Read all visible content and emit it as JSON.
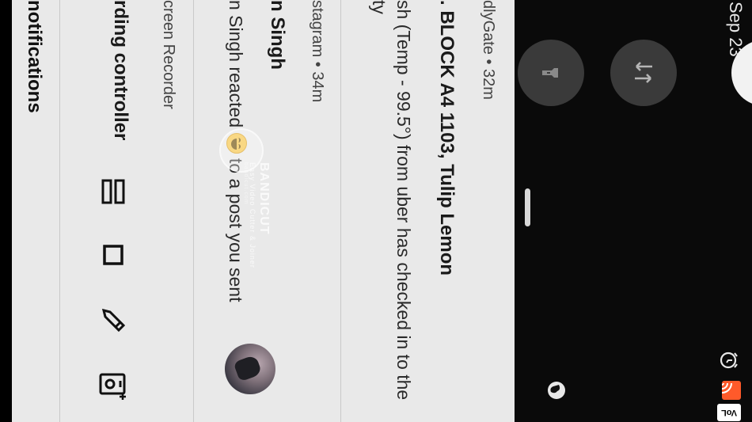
{
  "status_bar": {
    "date": "Sep 23",
    "icons": [
      "alarm-icon",
      "cast-icon",
      "volte-icon"
    ],
    "volte_label": "VoL"
  },
  "quick_settings": {
    "tiles": [
      {
        "name": "data-transfer-tile",
        "icon": "swap-arrows-icon"
      },
      {
        "name": "flashlight-tile",
        "icon": "flashlight-icon"
      },
      {
        "name": "auto-rotate-tile",
        "icon": "rotate-icon"
      },
      {
        "name": "battery-saver-tile",
        "icon": "battery-plus-icon"
      }
    ],
    "corner_icon": "globe-icon"
  },
  "notifications": [
    {
      "app_meta": "dlyGate • 32m",
      "title": ". BLOCK A4 1103, Tulip Lemon",
      "body_lines": [
        "sh (Temp - 99.5°) from uber has checked in to the",
        "ty"
      ]
    },
    {
      "app_meta": "stagram • 34m",
      "title": "n Singh",
      "body_before_emoji": "n Singh reacted ",
      "body_after_emoji": " to a post you sent",
      "emoji_name": "laughing-emoji-icon"
    },
    {
      "app_meta": "creen Recorder",
      "title": "rding controller",
      "actions": [
        {
          "name": "menu-button",
          "icon": "menu-icon"
        },
        {
          "name": "stop-button",
          "icon": "stop-icon"
        },
        {
          "name": "draw-button",
          "icon": "pencil-icon"
        },
        {
          "name": "camera-button",
          "icon": "camera-plus-icon"
        }
      ]
    }
  ],
  "watermark": {
    "brand": "BANDICUT",
    "tagline": "Easy Video Cutter & Joiner",
    "site": "bandicut.com"
  },
  "bottom_section": {
    "label": "notifications"
  }
}
